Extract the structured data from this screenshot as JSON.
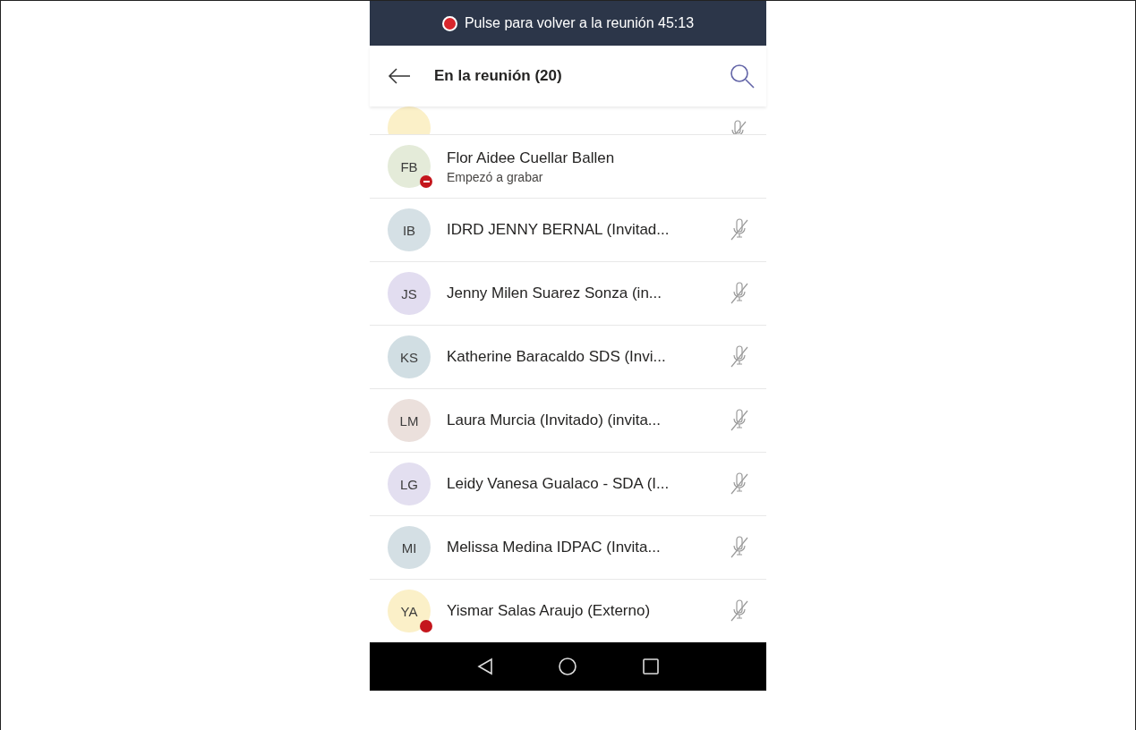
{
  "banner": {
    "text": "Pulse para volver a la reunión 45:13",
    "recording": true
  },
  "header": {
    "title": "En la reunión (20)"
  },
  "participants": [
    {
      "kind": "dnd",
      "initials": "FB",
      "name": "Flor Aidee Cuellar Ballen",
      "subtitle": "Empezó a grabar",
      "color": "#e4ebd9",
      "muted": false
    },
    {
      "kind": "plain",
      "initials": "IB",
      "name": "IDRD JENNY BERNAL (Invitad...",
      "color": "#d5e0e5",
      "muted": true
    },
    {
      "kind": "plain",
      "initials": "JS",
      "name": "Jenny Milen Suarez Sonza (in...",
      "color": "#e2ddf0",
      "muted": true
    },
    {
      "kind": "plain",
      "initials": "KS",
      "name": "Katherine Baracaldo SDS (Invi...",
      "color": "#d1dee3",
      "muted": true
    },
    {
      "kind": "plain",
      "initials": "LM",
      "name": "Laura Murcia (Invitado) (invita...",
      "color": "#ebe0dc",
      "muted": true
    },
    {
      "kind": "plain",
      "initials": "LG",
      "name": "Leidy Vanesa Gualaco - SDA (I...",
      "color": "#e3dff0",
      "muted": true
    },
    {
      "kind": "plain",
      "initials": "MI",
      "name": "Melissa Medina IDPAC (Invita...",
      "color": "#d4dfe4",
      "muted": true
    },
    {
      "kind": "busy",
      "initials": "YA",
      "name": "Yismar Salas Araujo (Externo)",
      "color": "#fbf0c8",
      "muted": true
    }
  ]
}
